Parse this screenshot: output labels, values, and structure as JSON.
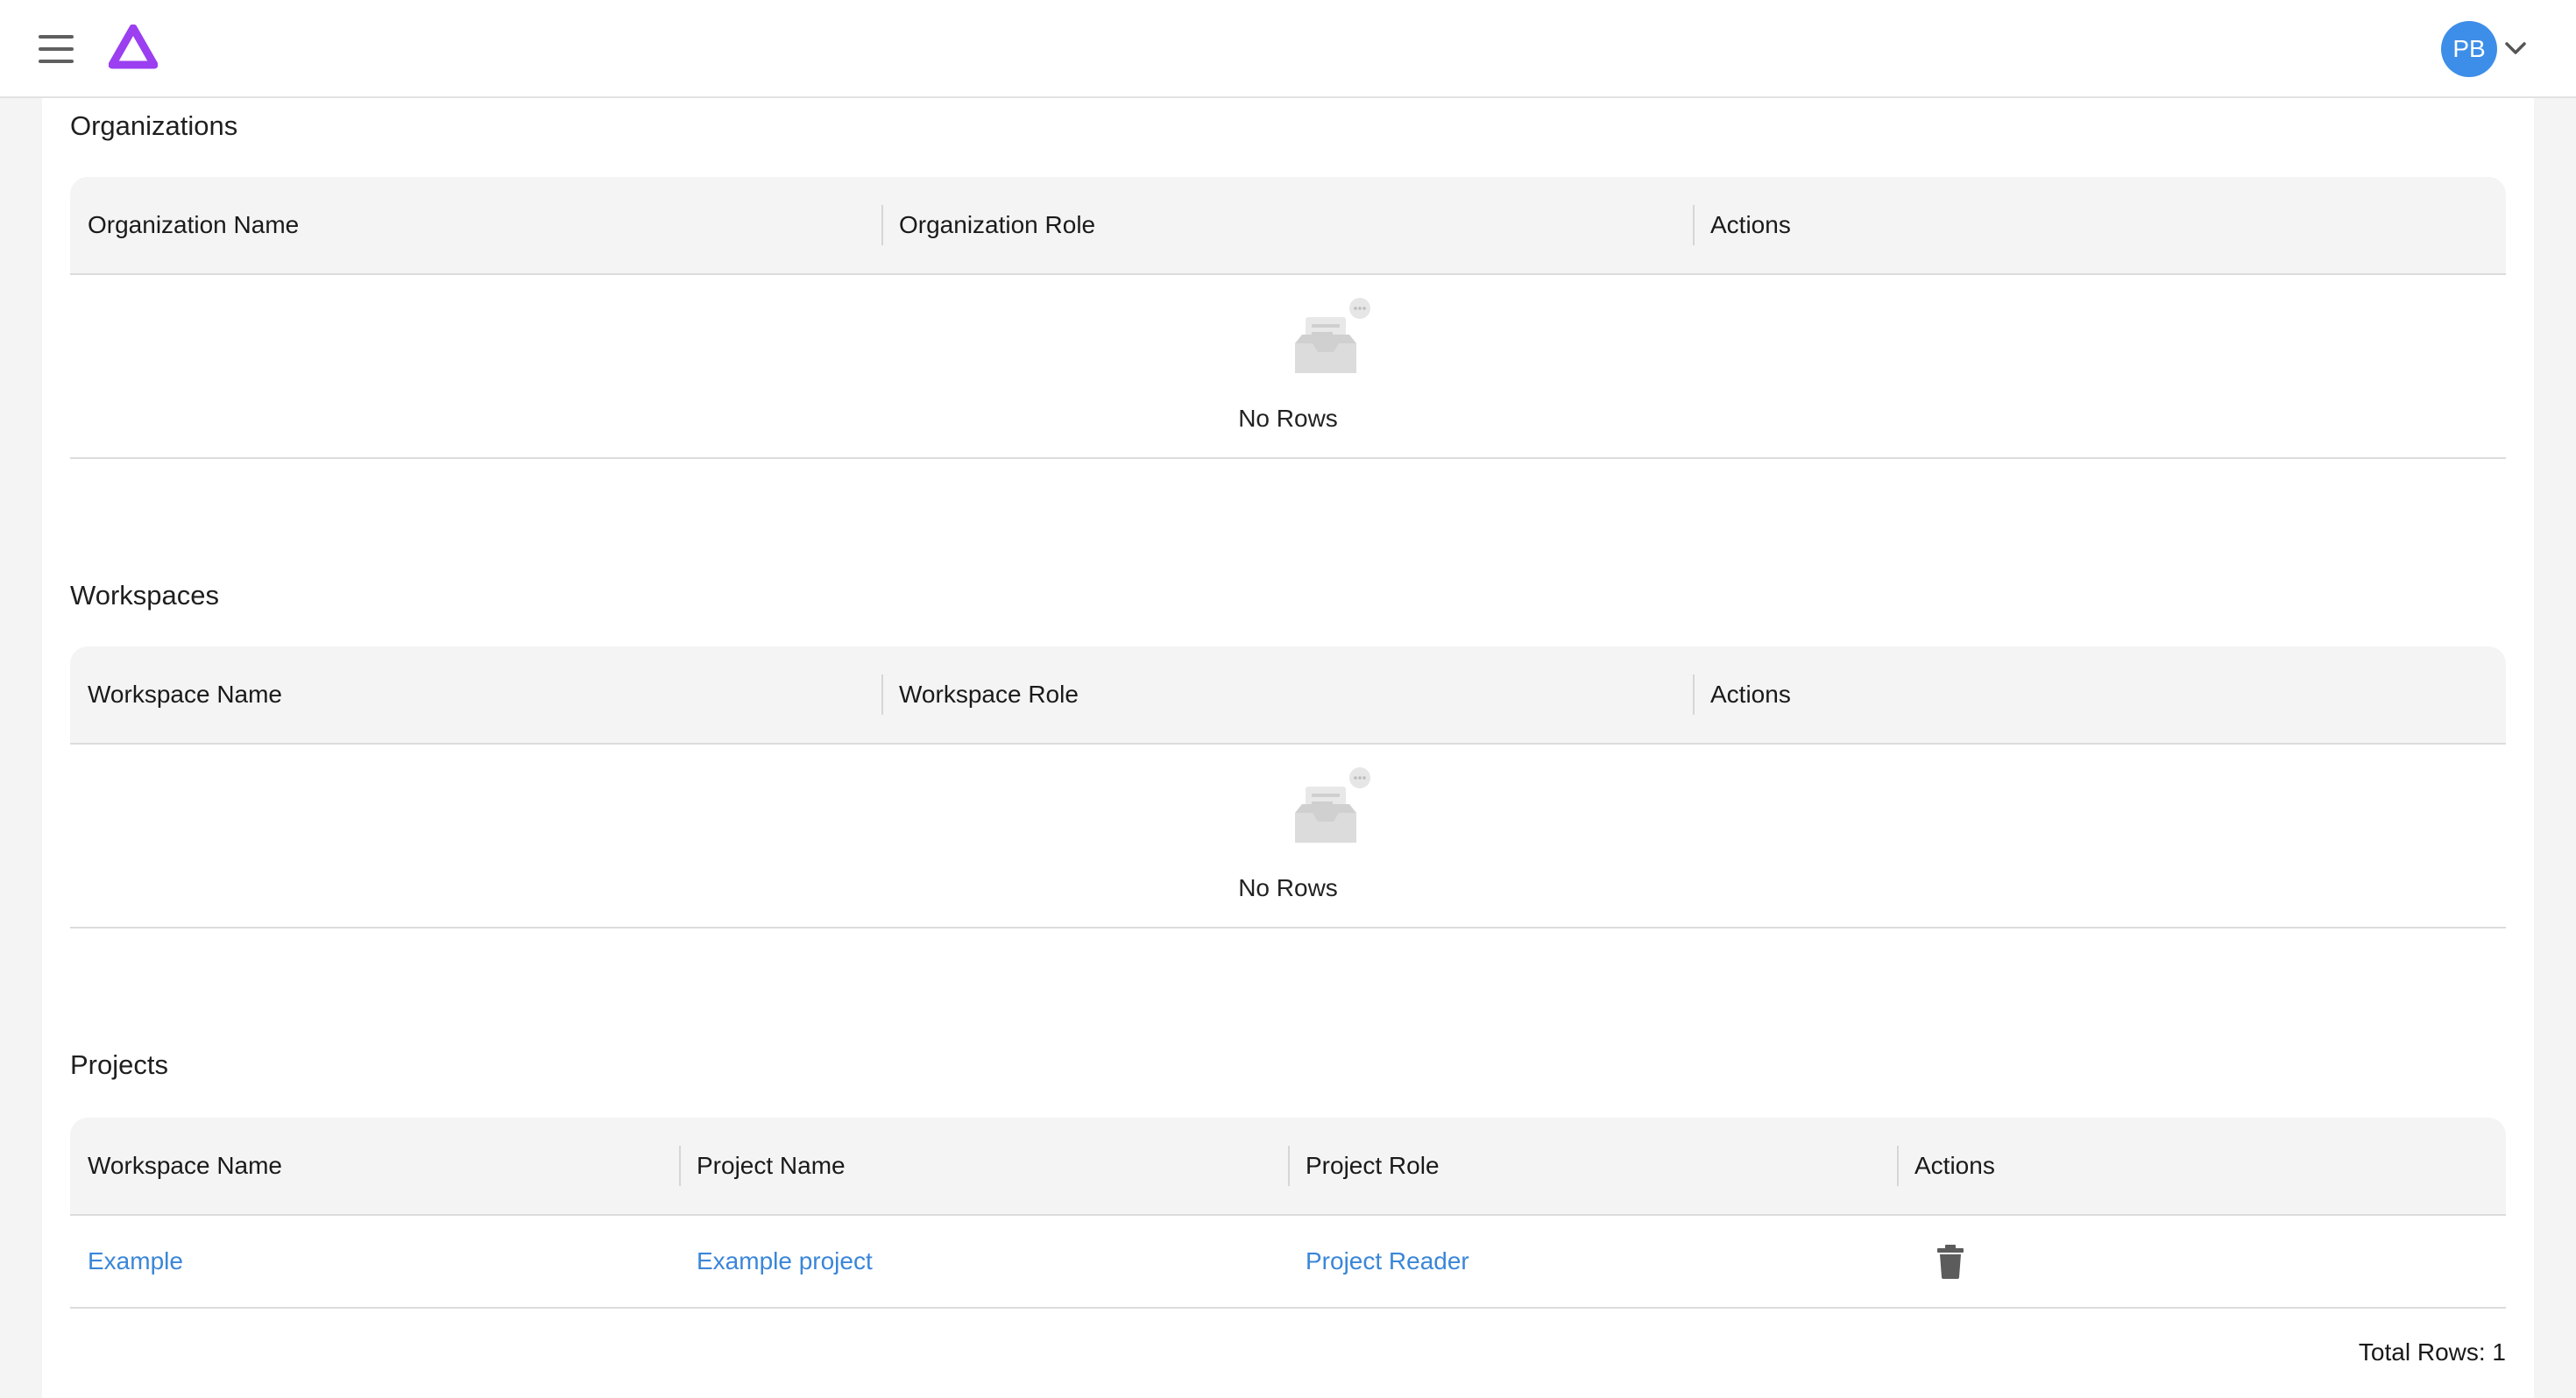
{
  "header": {
    "avatar_initials": "PB",
    "brand_color": "#9b3ff0",
    "avatar_color": "#3d8ee8"
  },
  "organizations": {
    "title": "Organizations",
    "columns": [
      "Organization Name",
      "Organization Role",
      "Actions"
    ],
    "empty_text": "No Rows"
  },
  "workspaces": {
    "title": "Workspaces",
    "columns": [
      "Workspace Name",
      "Workspace Role",
      "Actions"
    ],
    "empty_text": "No Rows"
  },
  "projects": {
    "title": "Projects",
    "columns": [
      "Workspace Name",
      "Project Name",
      "Project Role",
      "Actions"
    ],
    "rows": [
      {
        "workspace": "Example",
        "project": "Example project",
        "role": "Project Reader",
        "action_icon": "trash-icon"
      }
    ],
    "total_rows": "Total Rows: 1"
  },
  "link_color": "#3a86d8"
}
